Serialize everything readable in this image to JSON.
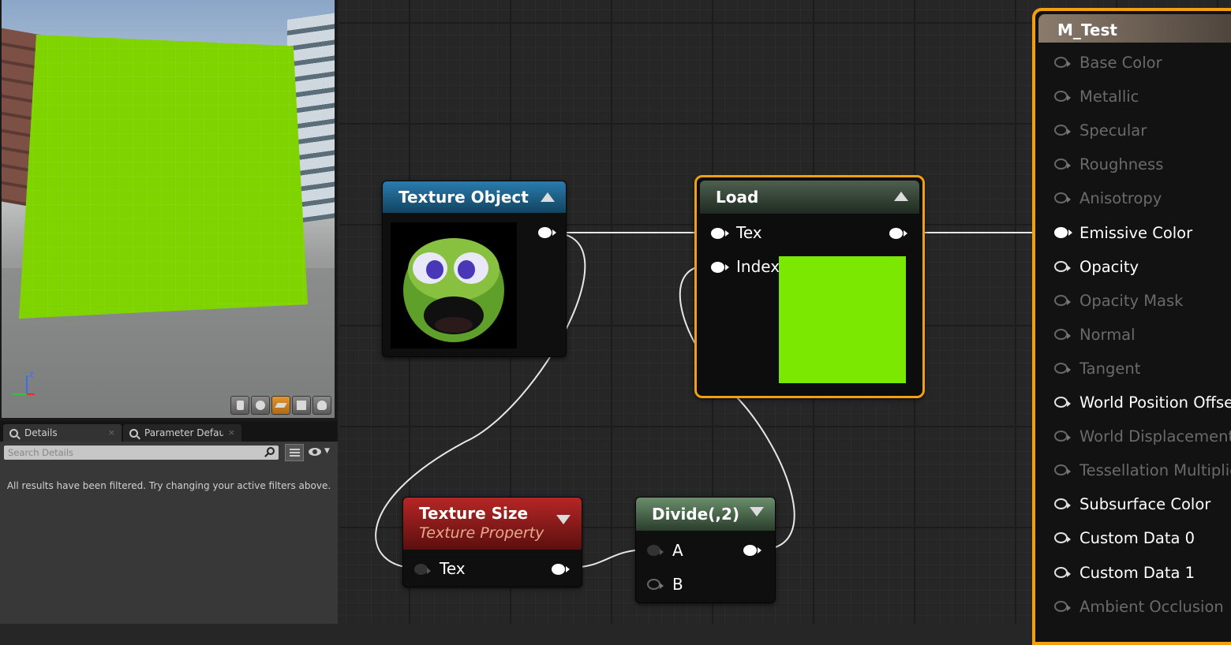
{
  "details_panel": {
    "tabs": [
      {
        "label": "Details",
        "close": "×"
      },
      {
        "label": "Parameter Defaults",
        "close": "×"
      }
    ],
    "search_placeholder": "Search Details",
    "message": "All results have been filtered. Try changing your active filters above."
  },
  "viewport": {
    "preview_color": "#7fd400",
    "toolbar_icons": [
      "cylinder-icon",
      "sphere-icon",
      "plane-icon",
      "cube-icon",
      "teapot-icon"
    ],
    "active_tool": "plane-icon"
  },
  "nodes": {
    "texture_object": {
      "title": "Texture Object"
    },
    "load": {
      "title": "Load",
      "inputs": [
        "Tex",
        "Index"
      ],
      "preview_color": "#7ae800"
    },
    "texture_size": {
      "title": "Texture Size",
      "subtitle": "Texture Property",
      "input": "Tex"
    },
    "divide": {
      "title": "Divide(,2)",
      "inputs": [
        "A",
        "B"
      ]
    }
  },
  "material": {
    "title": "M_Test",
    "inputs": [
      {
        "label": "Base Color",
        "enabled": false
      },
      {
        "label": "Metallic",
        "enabled": false
      },
      {
        "label": "Specular",
        "enabled": false
      },
      {
        "label": "Roughness",
        "enabled": false
      },
      {
        "label": "Anisotropy",
        "enabled": false
      },
      {
        "label": "Emissive Color",
        "enabled": true,
        "connected": true
      },
      {
        "label": "Opacity",
        "enabled": true
      },
      {
        "label": "Opacity Mask",
        "enabled": false
      },
      {
        "label": "Normal",
        "enabled": false
      },
      {
        "label": "Tangent",
        "enabled": false
      },
      {
        "label": "World Position Offset",
        "enabled": true
      },
      {
        "label": "World Displacement",
        "enabled": false
      },
      {
        "label": "Tessellation Multiplier",
        "enabled": false
      },
      {
        "label": "Subsurface Color",
        "enabled": true
      },
      {
        "label": "Custom Data 0",
        "enabled": true
      },
      {
        "label": "Custom Data 1",
        "enabled": true
      },
      {
        "label": "Ambient Occlusion",
        "enabled": false
      }
    ]
  }
}
